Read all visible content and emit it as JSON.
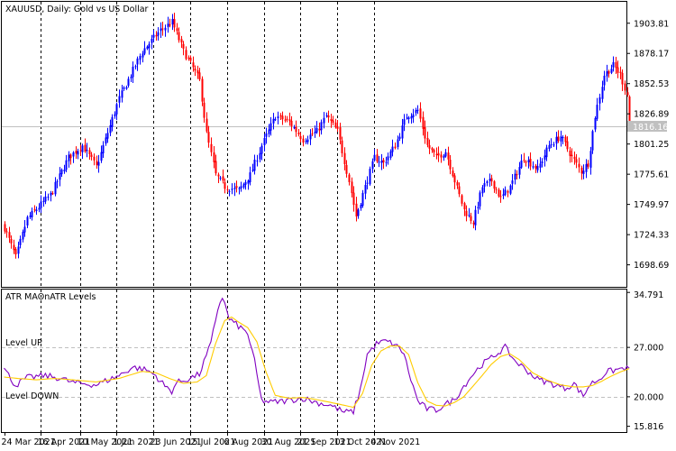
{
  "chart_data": [
    {
      "type": "candlestick",
      "title": "XAUUSD, Daily:  Gold vs US Dollar",
      "symbol": "XAUUSD",
      "timeframe": "Daily",
      "description": "Gold vs US Dollar",
      "ylim": [
        1680,
        1922
      ],
      "y_ticks": [
        "1903.81",
        "1878.17",
        "1852.53",
        "1826.89",
        "1801.25",
        "1775.61",
        "1749.97",
        "1724.33",
        "1698.69"
      ],
      "current_price": "1816.16",
      "grid": "vertical-dashed",
      "colors": {
        "bull": "#0000ff",
        "bear": "#ff0000",
        "price_line": "#c0c0c0"
      },
      "anchors": [
        [
          0,
          1730
        ],
        [
          5,
          1705
        ],
        [
          10,
          1738
        ],
        [
          20,
          1758
        ],
        [
          28,
          1790
        ],
        [
          34,
          1800
        ],
        [
          40,
          1782
        ],
        [
          50,
          1840
        ],
        [
          60,
          1880
        ],
        [
          68,
          1898
        ],
        [
          73,
          1905
        ],
        [
          78,
          1880
        ],
        [
          85,
          1855
        ],
        [
          88,
          1810
        ],
        [
          92,
          1775
        ],
        [
          96,
          1765
        ],
        [
          102,
          1762
        ],
        [
          107,
          1775
        ],
        [
          112,
          1800
        ],
        [
          118,
          1825
        ],
        [
          124,
          1820
        ],
        [
          130,
          1805
        ],
        [
          136,
          1812
        ],
        [
          140,
          1825
        ],
        [
          145,
          1812
        ],
        [
          150,
          1770
        ],
        [
          153,
          1740
        ],
        [
          157,
          1765
        ],
        [
          161,
          1790
        ],
        [
          165,
          1785
        ],
        [
          170,
          1800
        ],
        [
          175,
          1825
        ],
        [
          180,
          1830
        ],
        [
          184,
          1800
        ],
        [
          188,
          1790
        ],
        [
          192,
          1795
        ],
        [
          196,
          1770
        ],
        [
          200,
          1745
        ],
        [
          204,
          1735
        ],
        [
          208,
          1765
        ],
        [
          212,
          1770
        ],
        [
          216,
          1755
        ],
        [
          220,
          1765
        ],
        [
          226,
          1790
        ],
        [
          232,
          1780
        ],
        [
          237,
          1800
        ],
        [
          242,
          1808
        ],
        [
          247,
          1790
        ],
        [
          251,
          1778
        ],
        [
          254,
          1785
        ],
        [
          257,
          1825
        ],
        [
          261,
          1860
        ],
        [
          265,
          1868
        ],
        [
          268,
          1860
        ],
        [
          271,
          1843
        ],
        [
          272,
          1816
        ]
      ]
    },
    {
      "type": "line",
      "title": "ATR MAOnATR Levels",
      "ylim": [
        15.0,
        35.2
      ],
      "y_ticks": [
        "34.791",
        "27.000",
        "20.000",
        "15.816"
      ],
      "levels": [
        {
          "label": "Level UP",
          "value": 27.0
        },
        {
          "label": "Level DOWN",
          "value": 20.0
        }
      ],
      "series": [
        {
          "color": "#8000c0",
          "anchors": [
            [
              0,
              24.0
            ],
            [
              5,
              21.6
            ],
            [
              10,
              22.7
            ],
            [
              18,
              23.0
            ],
            [
              25,
              22.6
            ],
            [
              30,
              22.0
            ],
            [
              40,
              21.7
            ],
            [
              50,
              23.0
            ],
            [
              56,
              24.2
            ],
            [
              62,
              23.8
            ],
            [
              66,
              23.0
            ],
            [
              70,
              21.5
            ],
            [
              73,
              20.8
            ],
            [
              75,
              22.0
            ],
            [
              80,
              22.5
            ],
            [
              85,
              23.2
            ],
            [
              90,
              27.5
            ],
            [
              93,
              32.5
            ],
            [
              95,
              34.2
            ],
            [
              98,
              31.0
            ],
            [
              102,
              30.0
            ],
            [
              106,
              29.0
            ],
            [
              109,
              25.0
            ],
            [
              112,
              19.5
            ],
            [
              116,
              19.2
            ],
            [
              122,
              19.4
            ],
            [
              130,
              19.8
            ],
            [
              136,
              19.2
            ],
            [
              142,
              18.8
            ],
            [
              148,
              17.8
            ],
            [
              152,
              17.9
            ],
            [
              155,
              21.0
            ],
            [
              158,
              26.0
            ],
            [
              162,
              27.5
            ],
            [
              166,
              27.9
            ],
            [
              170,
              27.4
            ],
            [
              174,
              26.2
            ],
            [
              176,
              23.5
            ],
            [
              180,
              19.4
            ],
            [
              184,
              18.3
            ],
            [
              188,
              18.1
            ],
            [
              192,
              18.9
            ],
            [
              196,
              19.6
            ],
            [
              200,
              21.5
            ],
            [
              204,
              23.2
            ],
            [
              208,
              24.6
            ],
            [
              212,
              25.5
            ],
            [
              216,
              26.5
            ],
            [
              218,
              27.0
            ],
            [
              222,
              25.2
            ],
            [
              228,
              23.6
            ],
            [
              232,
              22.5
            ],
            [
              238,
              21.9
            ],
            [
              244,
              21.2
            ],
            [
              248,
              21.9
            ],
            [
              252,
              20.1
            ],
            [
              255,
              21.8
            ],
            [
              259,
              22.5
            ],
            [
              262,
              23.5
            ],
            [
              266,
              23.8
            ],
            [
              270,
              24.1
            ],
            [
              272,
              23.8
            ]
          ]
        },
        {
          "color": "#ffcc00",
          "anchors": [
            [
              0,
              22.8
            ],
            [
              6,
              22.6
            ],
            [
              14,
              22.4
            ],
            [
              22,
              22.6
            ],
            [
              30,
              22.4
            ],
            [
              40,
              22.1
            ],
            [
              50,
              22.6
            ],
            [
              60,
              23.6
            ],
            [
              66,
              23.4
            ],
            [
              72,
              22.6
            ],
            [
              78,
              21.9
            ],
            [
              84,
              22.1
            ],
            [
              88,
              23.0
            ],
            [
              92,
              27.5
            ],
            [
              96,
              30.8
            ],
            [
              99,
              31.3
            ],
            [
              102,
              30.6
            ],
            [
              106,
              29.8
            ],
            [
              110,
              27.8
            ],
            [
              114,
              23.5
            ],
            [
              118,
              20.2
            ],
            [
              124,
              19.8
            ],
            [
              130,
              19.9
            ],
            [
              136,
              19.6
            ],
            [
              142,
              19.2
            ],
            [
              148,
              18.8
            ],
            [
              152,
              18.5
            ],
            [
              156,
              20.5
            ],
            [
              160,
              24.5
            ],
            [
              164,
              26.5
            ],
            [
              168,
              27.2
            ],
            [
              172,
              27.2
            ],
            [
              176,
              26.0
            ],
            [
              180,
              22.0
            ],
            [
              184,
              19.4
            ],
            [
              188,
              18.8
            ],
            [
              192,
              18.7
            ],
            [
              196,
              19.2
            ],
            [
              200,
              20.0
            ],
            [
              204,
              21.5
            ],
            [
              208,
              23.0
            ],
            [
              212,
              24.6
            ],
            [
              216,
              25.7
            ],
            [
              220,
              26.1
            ],
            [
              224,
              25.3
            ],
            [
              230,
              23.4
            ],
            [
              236,
              22.4
            ],
            [
              242,
              21.7
            ],
            [
              248,
              21.4
            ],
            [
              252,
              21.4
            ],
            [
              256,
              21.6
            ],
            [
              260,
              22.2
            ],
            [
              264,
              22.9
            ],
            [
              268,
              23.5
            ],
            [
              272,
              24.0
            ]
          ]
        }
      ]
    }
  ],
  "x_axis": {
    "labels": [
      "24 Mar 2021",
      "16 Apr 2021",
      "10 May 2021",
      "1 Jun 2021",
      "23 Jun 2021",
      "15 Jul 2021",
      "6 Aug 2021",
      "30 Aug 2021",
      "21 Sep 2021",
      "13 Oct 2021",
      "4 Nov 2021"
    ]
  }
}
